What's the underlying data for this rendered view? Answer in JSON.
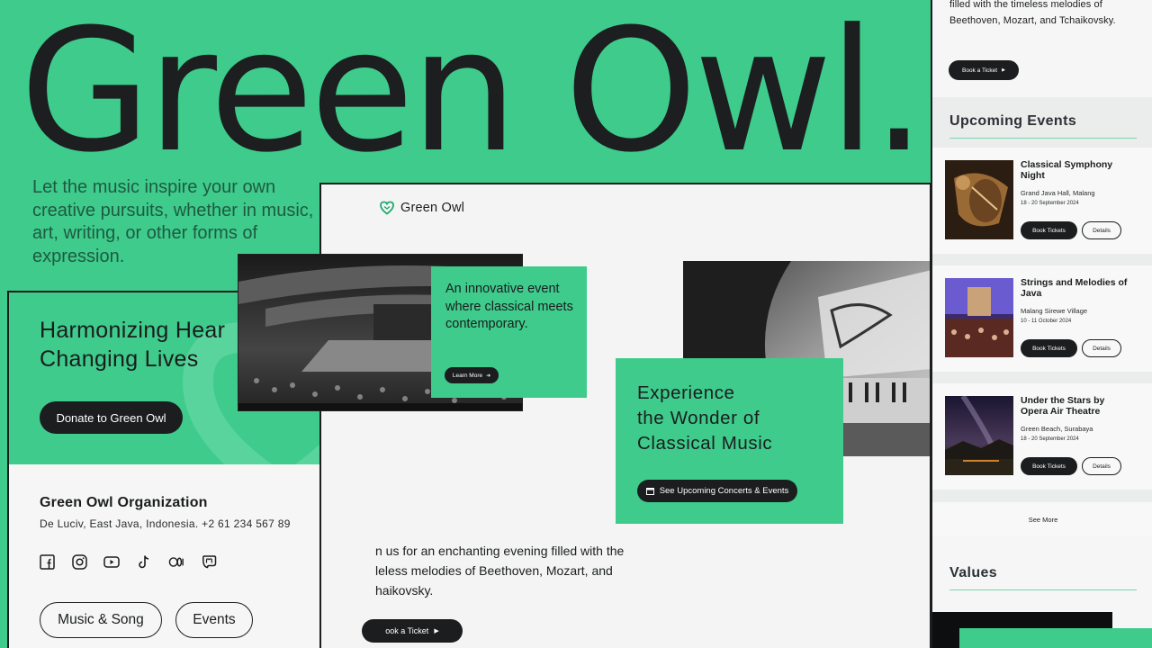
{
  "hero": {
    "title": "Green Owl.",
    "tagline": "Let the music inspire your own creative pursuits, whether in music, art, writing, or other forms of expression."
  },
  "donate_card": {
    "heading_line1": "Harmonizing Hear",
    "heading_line2": "Changing Lives",
    "donate_button": "Donate to Green Owl",
    "org_name": "Green Owl Organization",
    "org_address": "De Luciv, East Java, Indonesia. +2 61 234 567 89",
    "social_icons": [
      "facebook-icon",
      "instagram-icon",
      "youtube-icon",
      "tiktok-icon",
      "medium-icon",
      "mastodon-icon"
    ],
    "pills": [
      "Music & Song",
      "Events"
    ]
  },
  "center_page": {
    "brand_name": "Green Owl",
    "innovative_text": "An innovative event where classical meets contemporary.",
    "learn_more": "Learn More",
    "experience_line1": "Experience",
    "experience_line2": "the Wonder of",
    "experience_line3": "Classical Music",
    "experience_button": "See Upcoming Concerts & Events",
    "invite_text": "n us for an enchanting evening filled with the\nleless melodies of Beethoven, Mozart, and\nhaikovsky.",
    "ticket_button": "ook a Ticket"
  },
  "right_panel": {
    "top_text": "filled with the timeless melodies of Beethoven, Mozart, and Tchaikovsky.",
    "top_button": "Book a Ticket",
    "upcoming_title": "Upcoming Events",
    "events": [
      {
        "title": "Classical Symphony Night",
        "venue": "Grand Java Hall, Malang",
        "date": "18 - 20 September 2024",
        "book": "Book Tickets",
        "details": "Details"
      },
      {
        "title": "Strings and Melodies of Java",
        "venue": "Malang Sirewe Village",
        "date": "10 - 11 October 2024",
        "book": "Book Tickets",
        "details": "Details"
      },
      {
        "title": "Under the Stars by Opera Air Theatre",
        "venue": "Green Beach, Surabaya",
        "date": "18 - 20 September 2024",
        "book": "Book Tickets",
        "details": "Details"
      }
    ],
    "see_more": "See More",
    "values_title": "Values"
  },
  "colors": {
    "brand_green": "#3ecb8b",
    "ink": "#1b1d1f",
    "panel_bg": "#f5f6f5"
  }
}
